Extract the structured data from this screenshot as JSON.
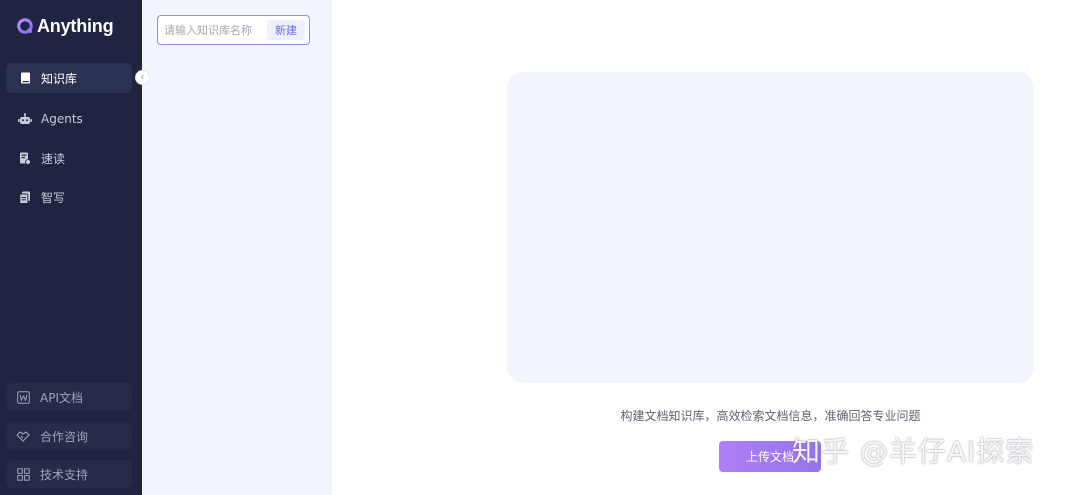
{
  "app": {
    "brand": "Anything"
  },
  "sidebar": {
    "items": [
      {
        "label": "知识库",
        "icon": "book-icon",
        "active": true
      },
      {
        "label": "Agents",
        "icon": "robot-icon",
        "active": false
      },
      {
        "label": "速读",
        "icon": "speed-read-icon",
        "active": false
      },
      {
        "label": "智写",
        "icon": "copy-doc-icon",
        "active": false
      }
    ],
    "bottom": [
      {
        "label": "API文档",
        "icon": "word-doc-icon"
      },
      {
        "label": "合作咨询",
        "icon": "handshake-icon"
      },
      {
        "label": "技术支持",
        "icon": "grid-icon"
      }
    ]
  },
  "knowledge_panel": {
    "input_placeholder": "请输入知识库名称",
    "new_button": "新建"
  },
  "main": {
    "description": "构建文档知识库，高效检索文档信息，准确回答专业问题",
    "upload_button": "上传文档"
  },
  "watermark": "知乎 @羊仔AI探索",
  "colors": {
    "sidebar_bg": "#1f2440",
    "panel_bg": "#f2f5fd",
    "accent": "#9474ee"
  }
}
